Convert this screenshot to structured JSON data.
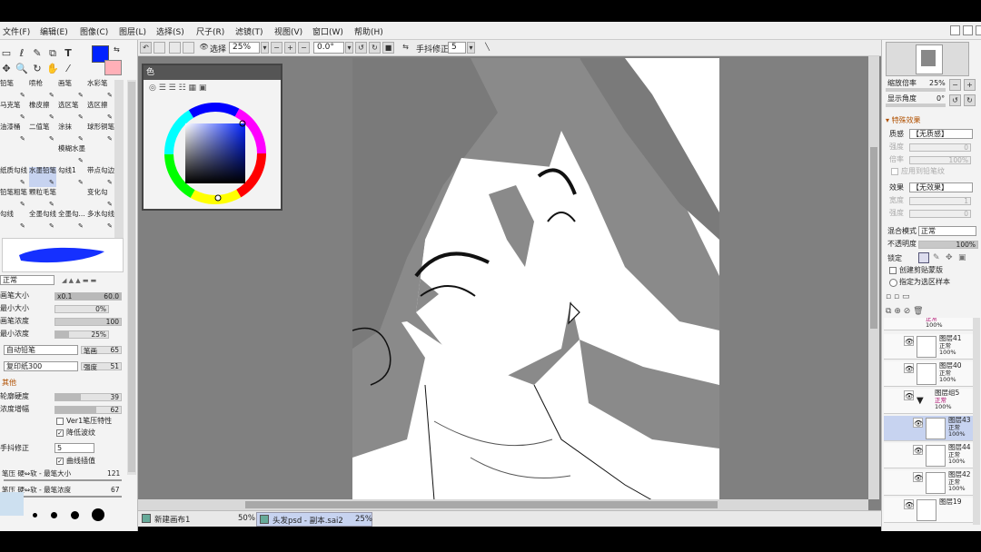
{
  "menu": [
    "文件(F)",
    "编辑(E)",
    "图像(C)",
    "图层(L)",
    "选择(S)",
    "尺子(R)",
    "滤镜(T)",
    "视图(V)",
    "窗口(W)",
    "帮助(H)"
  ],
  "toolbar": {
    "select_label": "选择",
    "zoom_value": "25%",
    "angle_value": "0.0°",
    "stabilizer_label": "手抖修正",
    "stabilizer_value": "5"
  },
  "brushes": [
    [
      "铅笔",
      "喷枪",
      "画笔",
      "水彩笔"
    ],
    [
      "马克笔",
      "橡皮擦",
      "选区笔",
      "选区擦"
    ],
    [
      "油漆桶",
      "二值笔",
      "涂抹",
      "球形铜笔"
    ],
    [
      "",
      "",
      "模糊水墨",
      ""
    ],
    [
      "纸质勾线",
      "水墨铅笔",
      "勾线1",
      "带点勾边"
    ],
    [
      "铅笔粗笔",
      "颗粒毛笔",
      "",
      "变化勾"
    ],
    [
      "勾线",
      "全墨勾线",
      "全墨勾...",
      "多水勾线"
    ]
  ],
  "brush_settings": {
    "blend_mode": "正常",
    "max_size_label": "画笔大小",
    "max_size_mult": "x0.1",
    "max_size_value": "60.0",
    "min_size_label": "最小大小",
    "min_size_value": "0%",
    "density_label": "画笔浓度",
    "density_value": "100",
    "min_density_label": "最小浓度",
    "min_density_value": "25%",
    "shape_select": "自动铅笔",
    "shape_label": "笔画",
    "shape_value": "65",
    "texture_select": "复印纸300",
    "texture_label": "强度",
    "texture_value": "51",
    "other_label": "其他",
    "hardness_label": "轮廓硬度",
    "hardness_value": "39",
    "density_inc_label": "浓度增幅",
    "density_inc_value": "62",
    "ver1_label": "Ver1笔压特性",
    "low_noise_label": "降低波纹",
    "stabilizer_label": "手抖修正",
    "stabilizer_value": "5",
    "curve_label": "曲线插值",
    "pressure1_label": "笔压 硬⇔软 - 最笔大小",
    "pressure1_value": "121",
    "pressure2_label": "笔压 硬⇔软 - 最笔浓度",
    "pressure2_value": "67"
  },
  "color_panel": {
    "title": "色"
  },
  "statusbar": {
    "doc1_name": "新建画布1",
    "doc1_zoom": "50%",
    "doc2_name": "头发psd - 副本.sai2",
    "doc2_zoom": "25%"
  },
  "navigator": {
    "zoom_label": "缩放倍率",
    "zoom_value": "25%",
    "angle_label": "显示角度",
    "angle_value": "0°"
  },
  "special_effects": {
    "title": "特殊效果",
    "texture_label": "质感",
    "texture_value": "【无质感】",
    "strength_label": "强度",
    "strength_value": "0",
    "scale_label": "倍率",
    "scale_value": "100%",
    "brush_texture_label": "应用到铅笔纹",
    "effect_label": "效果",
    "effect_value": "【无效果】",
    "width_label": "宽度",
    "width_value": "1",
    "strength2_label": "强度",
    "strength2_value": "0"
  },
  "layer_props": {
    "blend_label": "混合模式",
    "blend_value": "正常",
    "opacity_label": "不透明度",
    "opacity_value": "100%",
    "lock_label": "锁定",
    "clip_label": "创建剪贴蒙版",
    "sample_label": "指定为选区样本"
  },
  "layers": [
    {
      "name": "",
      "mode": "正常",
      "opacity": "100%",
      "folder": false,
      "active": false,
      "indent": false
    },
    {
      "name": "图层41",
      "mode": "正常",
      "opacity": "100%",
      "folder": false,
      "active": false,
      "indent": false
    },
    {
      "name": "图层40",
      "mode": "正常",
      "opacity": "100%",
      "folder": false,
      "active": false,
      "indent": false
    },
    {
      "name": "图层组5",
      "mode": "正常",
      "opacity": "100%",
      "folder": true,
      "active": false,
      "indent": false
    },
    {
      "name": "图层43",
      "mode": "正常",
      "opacity": "100%",
      "folder": false,
      "active": true,
      "indent": true
    },
    {
      "name": "图层44",
      "mode": "正常",
      "opacity": "100%",
      "folder": false,
      "active": false,
      "indent": true
    },
    {
      "name": "图层42",
      "mode": "正常",
      "opacity": "100%",
      "folder": false,
      "active": false,
      "indent": true
    },
    {
      "name": "图层19",
      "mode": "",
      "opacity": "",
      "folder": false,
      "active": false,
      "indent": false
    }
  ],
  "colors": {
    "primary": "#0022ff",
    "secondary": "#ffb0b8",
    "selection": "#c7d3f0",
    "folder_mode": "#aa0066"
  },
  "icons": [
    "new-layer-icon",
    "folder-icon",
    "trash-icon",
    "eye-icon",
    "rotate-icon",
    "flip-icon",
    "pen-icon",
    "lasso-icon",
    "hand-icon",
    "zoom-icon",
    "move-icon",
    "eyedropper-icon",
    "text-icon"
  ]
}
